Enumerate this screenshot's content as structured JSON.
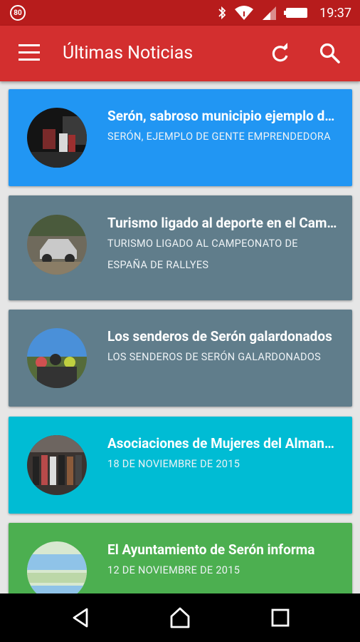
{
  "status_bar": {
    "badge": "80",
    "time": "19:37"
  },
  "app_bar": {
    "title": "Últimas Noticias",
    "menu_icon": "menu-icon",
    "refresh_icon": "refresh-icon",
    "search_icon": "search-icon"
  },
  "news": [
    {
      "title": "Serón, sabroso municipio ejemplo de gente emprendedora",
      "subtitle": "SERÓN, EJEMPLO DE GENTE EMPRENDEDORA",
      "color": "#2196f3"
    },
    {
      "title": "Turismo ligado al deporte en el Campeonato",
      "subtitle": "TURISMO LIGADO AL CAMPEONATO DE ESPAÑA DE RALLYES",
      "color": "#607d8b"
    },
    {
      "title": "Los senderos de Serón galardonados",
      "subtitle": "LOS SENDEROS DE SERÓN GALARDONADOS",
      "color": "#607d8b"
    },
    {
      "title": "Asociaciones de Mujeres del Almanzora",
      "subtitle": "18 DE NOVIEMBRE DE 2015",
      "color": "#00bcd4"
    },
    {
      "title": "El Ayuntamiento de Serón informa",
      "subtitle": "12 DE NOVIEMBRE DE 2015",
      "color": "#4caf50"
    }
  ],
  "nav_bar": {
    "back_icon": "back-icon",
    "home_icon": "home-icon",
    "recents_icon": "recents-icon"
  }
}
